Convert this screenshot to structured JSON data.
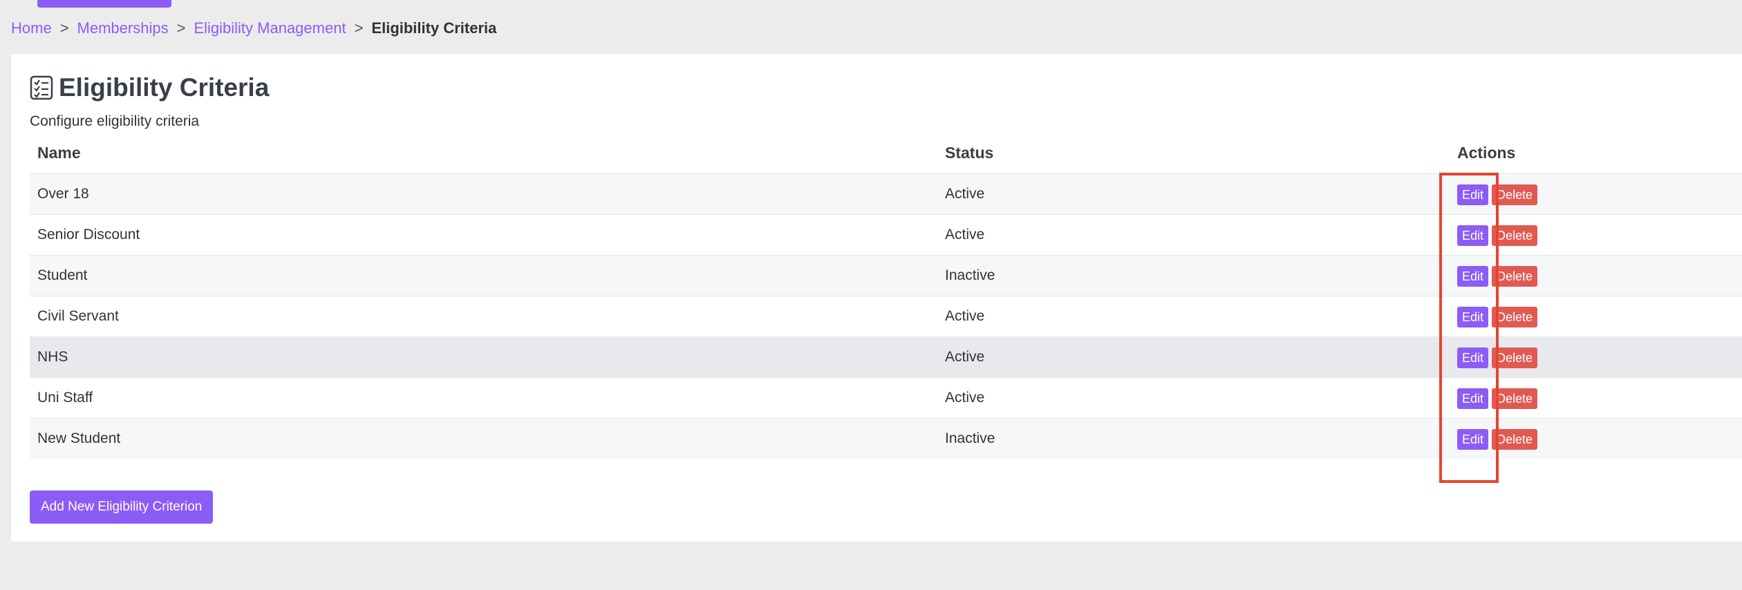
{
  "breadcrumb": {
    "items": [
      "Home",
      "Memberships",
      "Eligibility Management"
    ],
    "current": "Eligibility Criteria",
    "separator": ">"
  },
  "page": {
    "title": "Eligibility Criteria",
    "title_icon": "checklist-icon",
    "subtitle": "Configure eligibility criteria"
  },
  "table": {
    "headers": {
      "name": "Name",
      "status": "Status",
      "actions": "Actions"
    },
    "rows": [
      {
        "name": "Over 18",
        "status": "Active"
      },
      {
        "name": "Senior Discount",
        "status": "Active"
      },
      {
        "name": "Student",
        "status": "Inactive"
      },
      {
        "name": "Civil Servant",
        "status": "Active"
      },
      {
        "name": "NHS",
        "status": "Active"
      },
      {
        "name": "Uni Staff",
        "status": "Active"
      },
      {
        "name": "New Student",
        "status": "Inactive"
      }
    ],
    "edit_label": "Edit",
    "delete_label": "Delete"
  },
  "add_button_label": "Add New Eligibility Criterion",
  "colors": {
    "accent": "#8b5cf6",
    "danger": "#e05a52",
    "annotation": "#e8432e"
  }
}
